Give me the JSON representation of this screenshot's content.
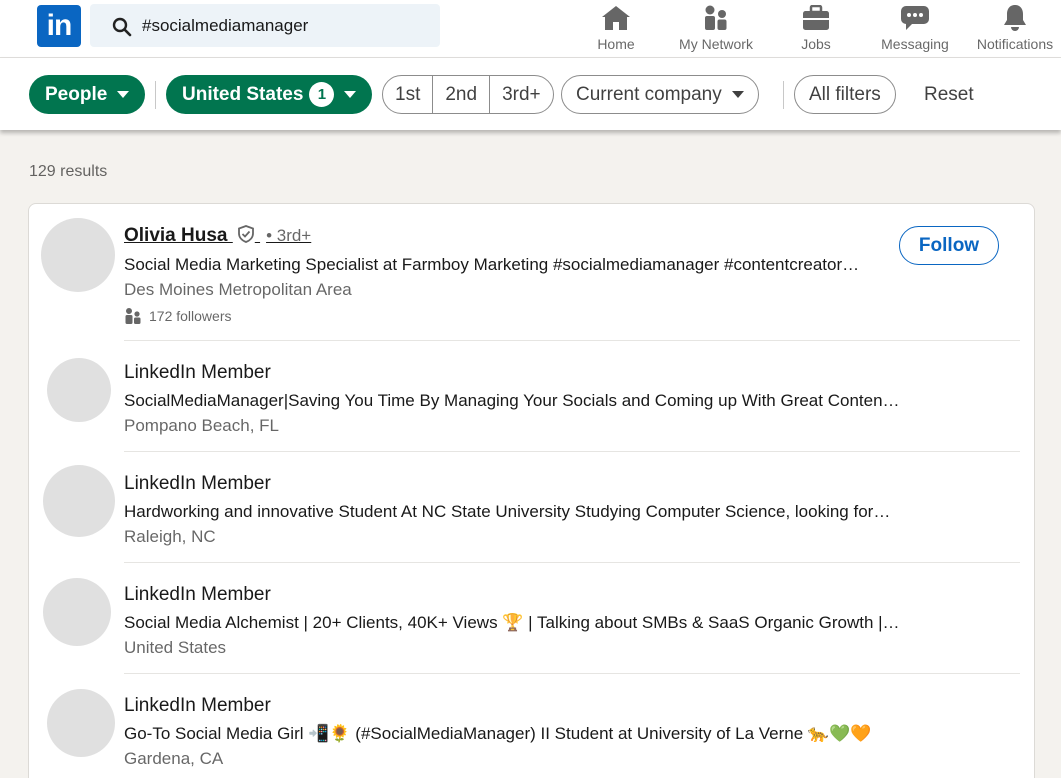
{
  "nav": {
    "logo_text": "in",
    "search_value": "#socialmediamanager",
    "items": [
      {
        "label": "Home",
        "icon": "home-icon"
      },
      {
        "label": "My Network",
        "icon": "network-icon"
      },
      {
        "label": "Jobs",
        "icon": "briefcase-icon"
      },
      {
        "label": "Messaging",
        "icon": "messaging-icon"
      },
      {
        "label": "Notifications",
        "icon": "bell-icon"
      }
    ]
  },
  "filters": {
    "people": "People",
    "location": "United States",
    "location_count": "1",
    "degrees": [
      "1st",
      "2nd",
      "3rd+"
    ],
    "current_company": "Current company",
    "all_filters": "All filters",
    "reset": "Reset"
  },
  "results_count": "129 results",
  "results": [
    {
      "name": "Olivia Husa",
      "degree": "• 3rd+",
      "headline": "Social Media Marketing Specialist at Farmboy Marketing #socialmediamanager #contentcreator…",
      "location": "Des Moines Metropolitan Area",
      "followers": "172 followers",
      "action": "Follow"
    },
    {
      "name": "LinkedIn Member",
      "headline": "SocialMediaManager|Saving You Time By Managing Your Socials and Coming up With Great Conten…",
      "location": "Pompano Beach, FL"
    },
    {
      "name": "LinkedIn Member",
      "headline": "Hardworking and innovative Student At NC State University Studying Computer Science, looking for…",
      "location": "Raleigh, NC"
    },
    {
      "name": "LinkedIn Member",
      "headline": "Social Media Alchemist | 20+ Clients, 40K+ Views 🏆 | Talking about SMBs & SaaS Organic Growth |…",
      "location": "United States"
    },
    {
      "name": "LinkedIn Member",
      "headline": "Go-To Social Media Girl 📲🌻 (#SocialMediaManager) II Student at University of La Verne 🐆💚🧡",
      "location": "Gardena, CA"
    }
  ],
  "colors": {
    "brand": "#0a66c2",
    "filter_green": "#01754f"
  }
}
